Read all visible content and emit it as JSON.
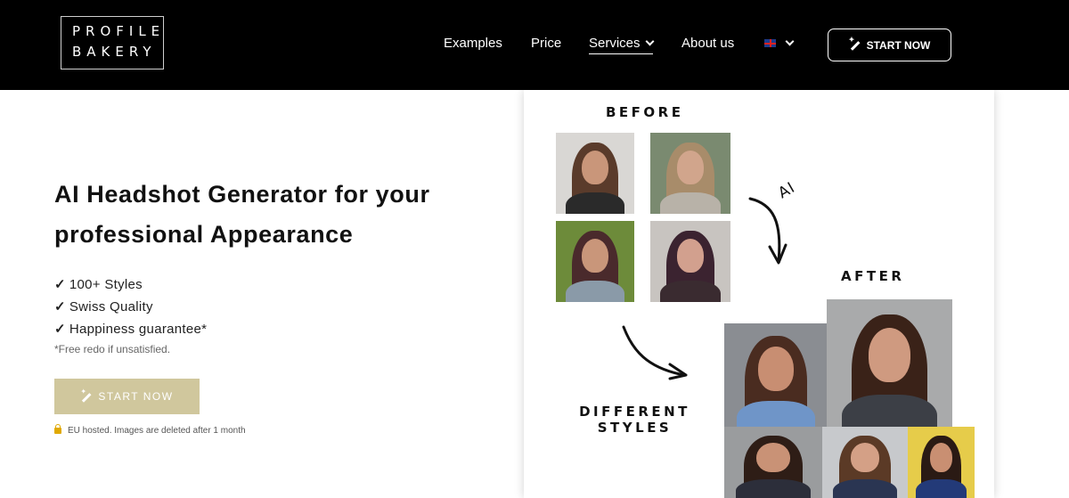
{
  "header": {
    "logo_line1": "PROFILE",
    "logo_line2": "BAKERY",
    "nav": [
      "Examples",
      "Price",
      "Services",
      "About us"
    ],
    "start_label": "START NOW"
  },
  "hero": {
    "title": "AI Headshot Generator for your professional Appearance",
    "features": [
      "100+ Styles",
      "Swiss Quality",
      "Happiness guarantee*"
    ],
    "check_glyph": "✓",
    "footnote": "*Free redo if unsatisfied.",
    "cta_label": "START NOW",
    "eu_note": "EU hosted. Images are deleted after 1 month"
  },
  "collage": {
    "before_label": "BEFORE",
    "ai_label": "AI",
    "after_label": "AFTER",
    "styles_label_line1": "DIFFERENT",
    "styles_label_line2": "STYLES"
  },
  "colors": {
    "header_bg": "#000000",
    "cta_bg": "#d0c79d",
    "text": "#111111"
  },
  "icons": [
    "wand-icon",
    "chevron-down-icon",
    "uk-flag-icon",
    "lock-icon",
    "arrow-icon"
  ]
}
